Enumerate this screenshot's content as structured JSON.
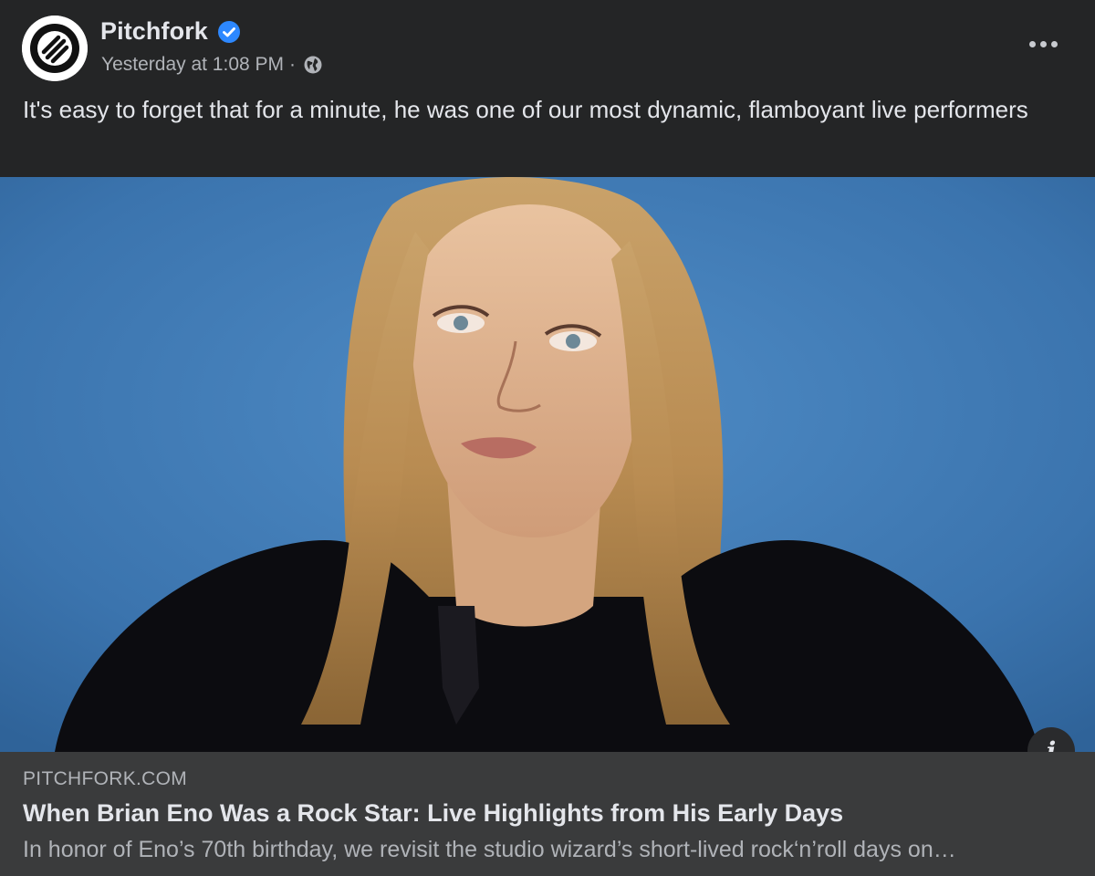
{
  "post": {
    "page_name": "Pitchfork",
    "verified_icon": "verified-badge-icon",
    "timestamp": "Yesterday at 1:08 PM",
    "separator": "·",
    "audience_icon": "globe-icon",
    "more_icon": "more-options-icon",
    "caption": "It's easy to forget that for a minute, he was one of our most dynamic, flamboyant live performers"
  },
  "link_preview": {
    "domain": "PITCHFORK.COM",
    "title": "When Brian Eno Was a Rock Star: Live Highlights from His Early Days",
    "description": "In honor of Eno’s 70th birthday, we revisit the studio wizard’s short-lived rock‘n’roll days on…",
    "info_icon": "info-icon"
  },
  "colors": {
    "background": "#242526",
    "primary_text": "#e4e6eb",
    "secondary_text": "#b0b3b8",
    "link_card": "#3a3b3c",
    "verified": "#2d88ff",
    "photo_backdrop": "#3d78b4"
  }
}
